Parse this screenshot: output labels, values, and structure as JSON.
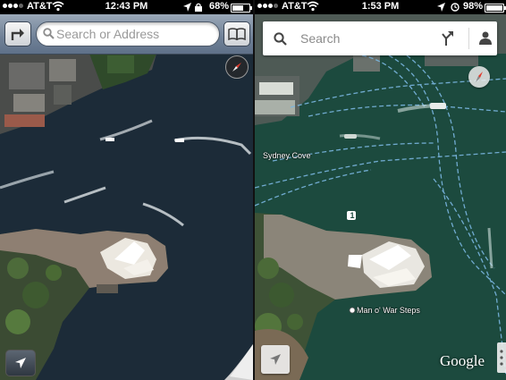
{
  "left_phone": {
    "status": {
      "carrier": "AT&T",
      "time": "12:43 PM",
      "battery": "68%",
      "battery_level": 0.68
    },
    "search_placeholder": "Search or Address",
    "icons": {
      "directions": "directions-arrow-icon",
      "bookmarks": "open-book-icon",
      "compass": "compass-icon",
      "tracking": "location-arrow-icon",
      "page_curl": "page-curl-icon"
    },
    "colors": {
      "toolbar": "#7a8aa0",
      "water": "#1c2b3a",
      "land": "#3e5a34"
    }
  },
  "right_phone": {
    "status": {
      "carrier": "AT&T",
      "time": "1:53 PM",
      "battery": "98%",
      "battery_level": 0.98
    },
    "search_placeholder": "Search",
    "map_labels": {
      "cove": "Sydney Cove",
      "steps": "Man o' War Steps",
      "marker": "1"
    },
    "brand": "Google",
    "icons": {
      "search": "search-icon",
      "directions": "directions-fork-icon",
      "account": "person-icon",
      "compass": "compass-icon",
      "tracking": "location-arrow-icon",
      "menu": "more-vertical-icon"
    },
    "colors": {
      "water": "#1d4a3f",
      "routes": "#7ab6e0",
      "searchbar": "#ffffff"
    }
  }
}
